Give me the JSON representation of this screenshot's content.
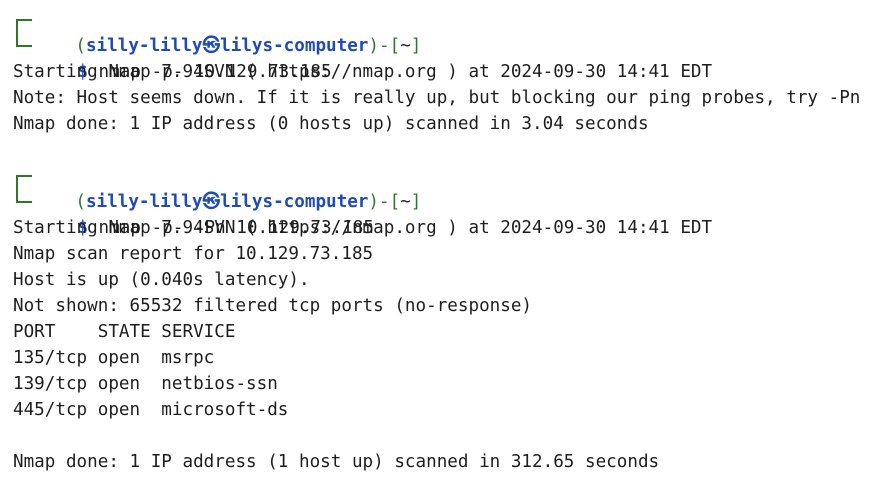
{
  "prompt1": {
    "open": "(",
    "user": "silly-lilly",
    "at_glyph": "㉿",
    "host": "lilys-computer",
    "close": ")-[",
    "dir": "~",
    "end": "]",
    "dollar": "$",
    "command": " nmap -p- 10.129.73.185"
  },
  "output1": [
    "Starting Nmap 7.94SVN ( https://nmap.org ) at 2024-09-30 14:41 EDT",
    "Note: Host seems down. If it is really up, but blocking our ping probes, try -Pn",
    "Nmap done: 1 IP address (0 hosts up) scanned in 3.04 seconds"
  ],
  "prompt2": {
    "open": "(",
    "user": "silly-lilly",
    "at_glyph": "㉿",
    "host": "lilys-computer",
    "close": ")-[",
    "dir": "~",
    "end": "]",
    "dollar": "$",
    "command": " nmap -p- -Pn 10.129.73.185"
  },
  "output2": [
    "Starting Nmap 7.94SVN ( https://nmap.org ) at 2024-09-30 14:41 EDT",
    "Nmap scan report for 10.129.73.185",
    "Host is up (0.040s latency).",
    "Not shown: 65532 filtered tcp ports (no-response)",
    "PORT    STATE SERVICE",
    "135/tcp open  msrpc",
    "139/tcp open  netbios-ssn",
    "445/tcp open  microsoft-ds",
    "",
    "Nmap done: 1 IP address (1 host up) scanned in 312.65 seconds"
  ]
}
